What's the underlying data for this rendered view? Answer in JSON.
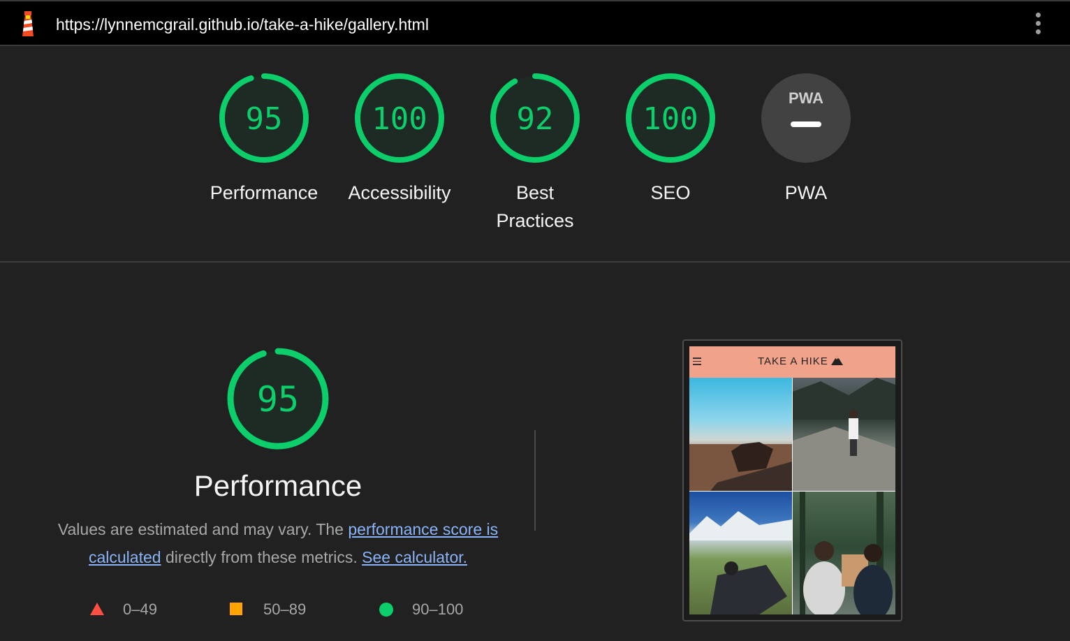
{
  "browser": {
    "url": "https://lynnemcgrail.github.io/take-a-hike/gallery.html",
    "logo_icon": "lighthouse-icon",
    "menu_icon": "kebab-menu-icon"
  },
  "colors": {
    "pass": "#0cce6b",
    "average": "#ffa400",
    "fail": "#ff4e42",
    "gauge_fill": "#1d2b24",
    "pwa_fill": "#424242",
    "link": "#8ab4f8",
    "phone_header": "#f0a28a"
  },
  "gauges": [
    {
      "label": "Performance",
      "score": "95",
      "value": 95
    },
    {
      "label": "Accessibility",
      "score": "100",
      "value": 100
    },
    {
      "label": "Best Practices",
      "score": "92",
      "value": 92
    },
    {
      "label": "SEO",
      "score": "100",
      "value": 100
    },
    {
      "label": "PWA",
      "badge": "PWA",
      "icon": "pwa-dash-icon"
    }
  ],
  "performance": {
    "score": "95",
    "value": 95,
    "title": "Performance",
    "desc_prefix": "Values are estimated and may vary. The ",
    "link_score": "performance score is calculated",
    "desc_middle": " directly from these metrics. ",
    "link_calculator": "See calculator."
  },
  "legend": [
    {
      "shape": "triangle-icon",
      "range": "0–49"
    },
    {
      "shape": "square-icon",
      "range": "50–89"
    },
    {
      "shape": "circle-icon",
      "range": "90–100"
    }
  ],
  "screenshot": {
    "brand": "TAKE A HIKE",
    "menu_icon": "hamburger-icon",
    "brand_icon": "mountain-icon"
  }
}
